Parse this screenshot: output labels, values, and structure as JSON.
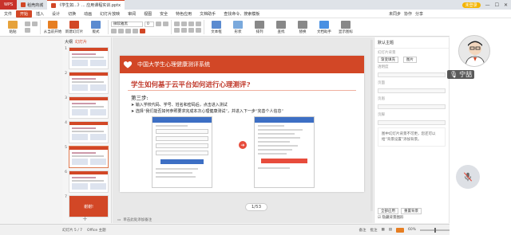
{
  "titlebar": {
    "tabs": [
      {
        "label": "WPS",
        "kind": "wps"
      },
      {
        "label": "稻壳商城",
        "kind": "normal"
      },
      {
        "label": "《学生如...》... 应用课程实训.pptx",
        "kind": "active"
      }
    ],
    "login_label": "未登录"
  },
  "menubar": {
    "file_label": "文件",
    "items": [
      "开始",
      "插入",
      "设计",
      "切换",
      "动画",
      "幻灯片放映",
      "审阅",
      "视图",
      "安全",
      "特色应用",
      "文档助手"
    ],
    "selected": "开始",
    "search_label": "查找命令、搜索模板",
    "right_items": [
      "未同步",
      "协作",
      "分享"
    ]
  },
  "toolbar": {
    "big_buttons": [
      {
        "label": "粘贴",
        "color": "#e6a23c"
      },
      {
        "label": "新建幻灯片",
        "color": "#d24726"
      },
      {
        "label": "版式",
        "color": "#5b8bd0"
      },
      {
        "label": "从当前开始",
        "color": "#e67e22"
      }
    ],
    "font_name": "微软雅黑",
    "font_size": "0",
    "right_buttons": [
      {
        "label": "文本框",
        "color": "#5b8bd0"
      },
      {
        "label": "形状",
        "color": "#7aa9dc"
      },
      {
        "label": "排列",
        "color": "#888888"
      },
      {
        "label": "查找",
        "color": "#888888"
      },
      {
        "label": "替换",
        "color": "#888888"
      },
      {
        "label": "文档助手",
        "color": "#4a90e2"
      },
      {
        "label": "显示图标",
        "color": "#888888"
      }
    ]
  },
  "thumbnail_pane": {
    "tabs": [
      "大纲",
      "幻灯片"
    ],
    "active_tab": "幻灯片",
    "slides": [
      {
        "num": "1",
        "kind": "content"
      },
      {
        "num": "2",
        "kind": "content"
      },
      {
        "num": "3",
        "kind": "content"
      },
      {
        "num": "4",
        "kind": "content"
      },
      {
        "num": "5",
        "kind": "selected"
      },
      {
        "num": "6",
        "kind": "content"
      },
      {
        "num": "7",
        "kind": "red",
        "text": "谢谢!"
      }
    ],
    "add_label": "+"
  },
  "slide": {
    "header_text": "中国大学生心理健康测评系统",
    "title": "学生如何基于云平台如何进行心理测评?",
    "step_title": "第三步:",
    "bullets": [
      "输入学校代码、学号、姓名和密码后，点击进入测试",
      "选择“我们能否如何参照要求完成本次心理健康测试”，并进入下一步“完善个人信息”"
    ],
    "arrow_symbol": "➔"
  },
  "page_counter": "1/53",
  "notes_bar": {
    "label": "单击此处添加备注"
  },
  "right_pane": {
    "title": "默认主题",
    "section_label": "幻灯片背景",
    "chip_labels": [
      "渐变填充",
      "图片"
    ],
    "field_labels": [
      "透明度",
      "页面",
      "页眉",
      "页脚"
    ],
    "note": "图中幻灯片背景不可更，您还可以给“背景设置”添加背景。",
    "buttons": [
      "全部应用",
      "重置背景"
    ],
    "checkbox_label": "隐藏背景图形"
  },
  "status_bar": {
    "slide_info": "幻灯片 5 / 7",
    "theme": "Office 主题",
    "right_items": [
      "备注",
      "批注"
    ],
    "zoom": "60%"
  },
  "video": {
    "name": "宁喆",
    "accent": "#d24726"
  }
}
